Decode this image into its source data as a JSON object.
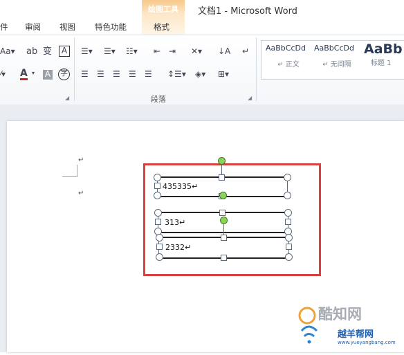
{
  "window": {
    "title": "文档1 - Microsoft Word",
    "contextual_group": "绘图工具"
  },
  "tabs": [
    {
      "label": "件"
    },
    {
      "label": "审阅"
    },
    {
      "label": "视图"
    },
    {
      "label": "特色功能"
    },
    {
      "label": "格式"
    }
  ],
  "ribbon": {
    "font_size_label": "Aa",
    "paragraph_group_label": "段落",
    "styles": [
      {
        "preview": "AaBbCcDd",
        "name": "↵ 正文"
      },
      {
        "preview": "AaBbCcDd",
        "name": "↵ 无间隔"
      },
      {
        "preview": "AaBb",
        "name": "标题 1"
      }
    ]
  },
  "document": {
    "paragraph_mark": "↵",
    "textboxes": [
      {
        "text": "435335↵"
      },
      {
        "text": "313↵"
      },
      {
        "text": "2332↵"
      }
    ]
  },
  "watermark": {
    "brand": "酷知网",
    "subbrand": "越羊帮网",
    "url": "www.yueyangbang.com"
  },
  "colors": {
    "highlight_border": "#d9413e",
    "rotation_handle": "#8bd35a",
    "contextual_tab": "#f7c88a"
  }
}
